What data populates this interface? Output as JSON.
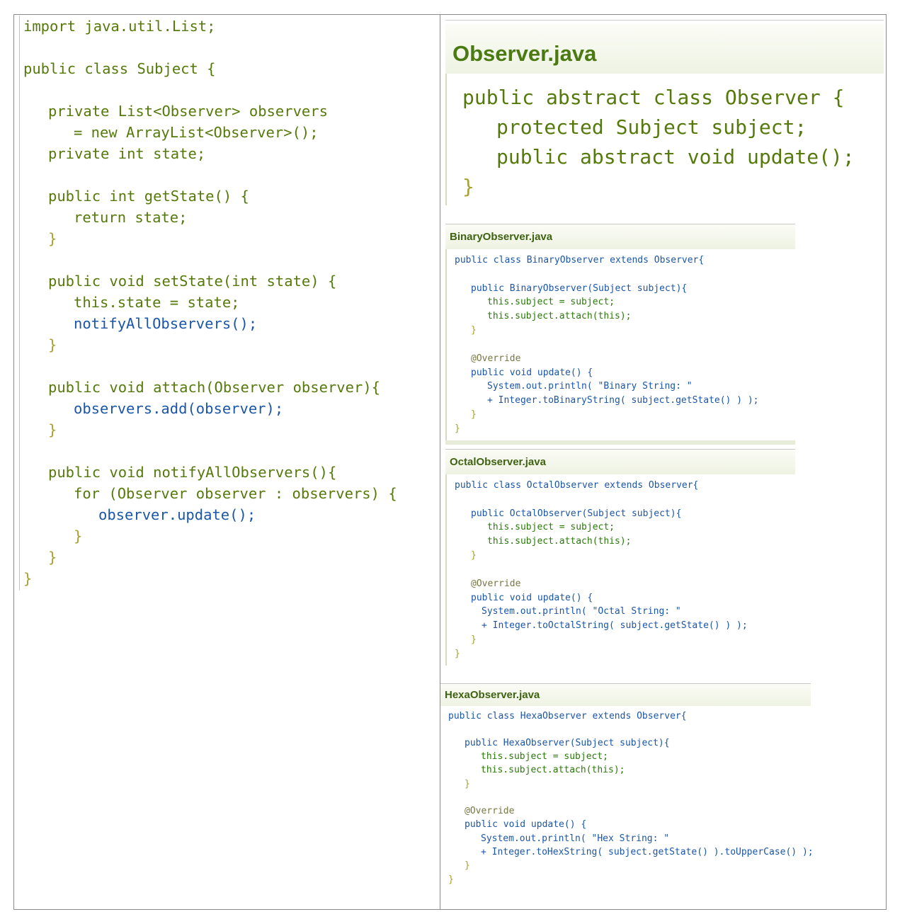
{
  "subject_java": {
    "lines": [
      "import java.util.List;",
      "",
      "public class Subject {",
      "",
      "private List<Observer> observers",
      "= new ArrayList<Observer>();",
      "private int state;",
      "",
      "public int getState() {",
      "return state;",
      "}",
      "",
      "public void setState(int state) {",
      "this.state = state;",
      "notifyAllObservers();",
      "}",
      "",
      "public void attach(Observer observer){",
      "observers.add(observer);",
      "}",
      "",
      "public void notifyAllObservers(){",
      "for (Observer observer : observers) {",
      "observer.update();",
      "}",
      "}",
      "}"
    ]
  },
  "observer_java": {
    "title": "Observer.java",
    "lines": [
      "public abstract class Observer {",
      "protected Subject subject;",
      "public abstract void update();",
      "}"
    ]
  },
  "binary_observer_java": {
    "title": "BinaryObserver.java",
    "lines": [
      "public class BinaryObserver extends Observer{",
      "public BinaryObserver(Subject subject){",
      "this.subject = subject;",
      "this.subject.attach(this);",
      "}",
      "@Override",
      "public void update() {",
      "System.out.println( \"Binary String: \"",
      "+ Integer.toBinaryString( subject.getState() ) );",
      "}",
      "}"
    ]
  },
  "octal_observer_java": {
    "title": "OctalObserver.java",
    "lines": [
      "public class OctalObserver extends Observer{",
      "public OctalObserver(Subject subject){",
      "this.subject = subject;",
      "this.subject.attach(this);",
      "}",
      "@Override",
      "public void update() {",
      "System.out.println( \"Octal String: \"",
      "+ Integer.toOctalString( subject.getState() ) );",
      "}",
      "}"
    ]
  },
  "hexa_observer_java": {
    "title": "HexaObserver.java",
    "lines": [
      "public class HexaObserver extends Observer{",
      "public HexaObserver(Subject subject){",
      "this.subject = subject;",
      "this.subject.attach(this);",
      "}",
      "@Override",
      "public void update() {",
      "System.out.println( \"Hex String: \"",
      "+ Integer.toHexString( subject.getState() ).toUpperCase() );",
      "}",
      "}"
    ]
  }
}
